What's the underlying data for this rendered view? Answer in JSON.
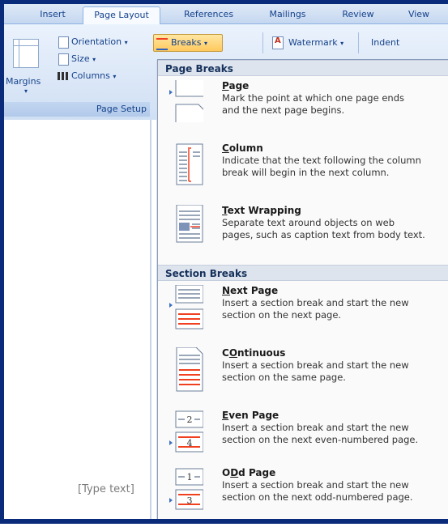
{
  "tabs": [
    "Insert",
    "Page Layout",
    "References",
    "Mailings",
    "Review",
    "View"
  ],
  "ribbon": {
    "margins": "Margins",
    "orientation": "Orientation",
    "size": "Size",
    "columns": "Columns",
    "breaks": "Breaks",
    "watermark": "Watermark",
    "indent": "Indent",
    "group_caption": "Page Setup"
  },
  "document": {
    "placeholder": "[Type text]"
  },
  "menu": {
    "page_breaks_header": "Page Breaks",
    "section_breaks_header": "Section Breaks",
    "items": [
      {
        "title_key": "P",
        "title_rest": "age",
        "desc_line1": "Mark the point at which one page ends",
        "desc_line2": "and the next page begins."
      },
      {
        "title_key": "C",
        "title_rest": "olumn",
        "desc_line1": "Indicate that the text following the column",
        "desc_line2": "break will begin in the next column."
      },
      {
        "title_key": "T",
        "title_rest": "ext Wrapping",
        "desc_line1": "Separate text around objects on web",
        "desc_line2": "pages, such as caption text from body text."
      },
      {
        "title_key": "N",
        "title_rest": "ext Page",
        "desc_line1": "Insert a section break and start the new",
        "desc_line2": "section on the next page."
      },
      {
        "title_key": "O",
        "title_rest": "ntinuous",
        "title_prefix": "C",
        "desc_line1": "Insert a section break and start the new",
        "desc_line2": "section on the same page."
      },
      {
        "title_key": "E",
        "title_rest": "ven Page",
        "desc_line1": "Insert a section break and start the new",
        "desc_line2": "section on the next even-numbered page."
      },
      {
        "title_key": "D",
        "title_rest": "d Page",
        "title_prefix": "O",
        "desc_line1": "Insert a section break and start the new",
        "desc_line2": "section on the next odd-numbered page."
      }
    ],
    "even_icon_digits": [
      "2",
      "4"
    ],
    "odd_icon_digits": [
      "1",
      "3"
    ]
  },
  "colors": {
    "accent": "#15428b",
    "frame": "#0a2a7a",
    "break_line": "#f04020"
  }
}
